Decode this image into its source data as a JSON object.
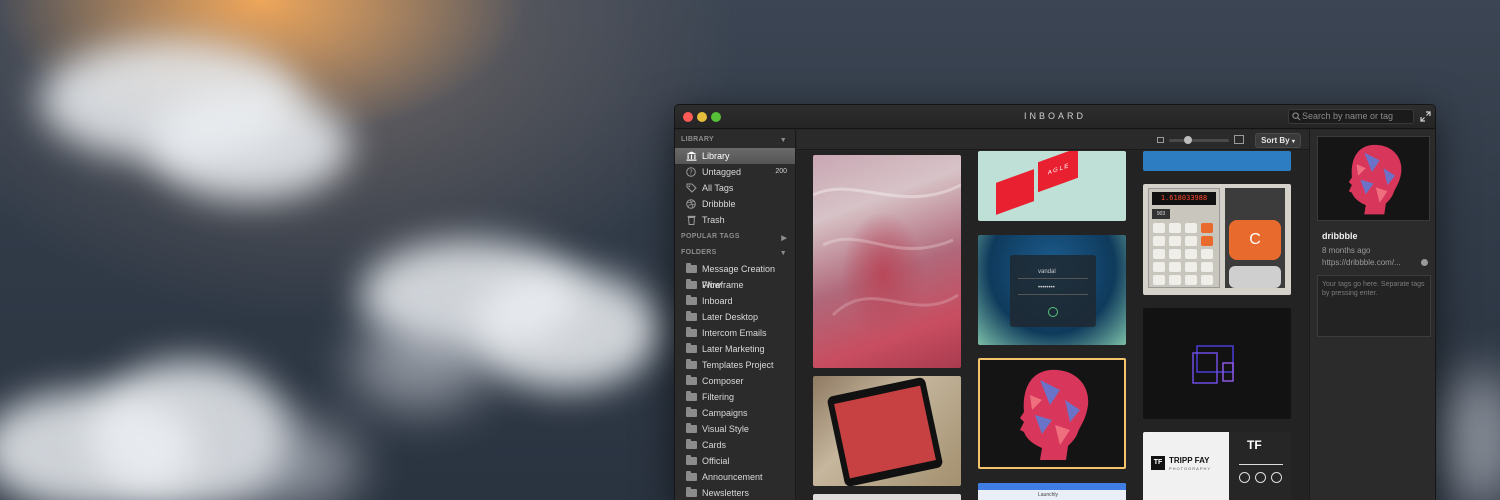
{
  "window": {
    "title": "INBOARD"
  },
  "search": {
    "placeholder": "Search by name or tag"
  },
  "sidebar": {
    "library_heading": "LIBRARY",
    "library_items": [
      {
        "label": "Library",
        "icon": "library-icon",
        "selected": true
      },
      {
        "label": "Untagged",
        "icon": "question-icon",
        "count": "200"
      },
      {
        "label": "All Tags",
        "icon": "tag-icon"
      },
      {
        "label": "Dribbble",
        "icon": "dribbble-icon"
      },
      {
        "label": "Trash",
        "icon": "trash-icon"
      }
    ],
    "popular_tags_heading": "POPULAR TAGS",
    "folders_heading": "FOLDERS",
    "folders": [
      "Message Creation Flow",
      "Wireframe",
      "Inboard",
      "Later Desktop",
      "Intercom Emails",
      "Later Marketing",
      "Templates Project",
      "Composer",
      "Filtering",
      "Campaigns",
      "Visual Style",
      "Cards",
      "Official",
      "Announcement",
      "Newsletters"
    ]
  },
  "toolbar": {
    "sort_label": "Sort By"
  },
  "grid": {
    "login_card": {
      "username": "vandal",
      "password": "••••••••"
    },
    "calculator": {
      "display": "1.618033988",
      "key_small": "903",
      "key_c": "C"
    },
    "tripp_fay": {
      "name": "TRIPP FAY",
      "sub": "PHOTOGRAPHY",
      "logo": "TF"
    },
    "brand_card": {
      "text": "A G L E"
    },
    "app_header": {
      "text": "Launchly"
    }
  },
  "panel": {
    "title": "dribbble",
    "date": "8 months ago",
    "url": "https://dribbble.com/...",
    "tags_placeholder": "Your tags go here. Separate tags by pressing enter."
  },
  "colors": {
    "selection_border": "#f3c46b",
    "accent_orange": "#e86a2c",
    "sidebar_bg": "#2b2b2b"
  }
}
